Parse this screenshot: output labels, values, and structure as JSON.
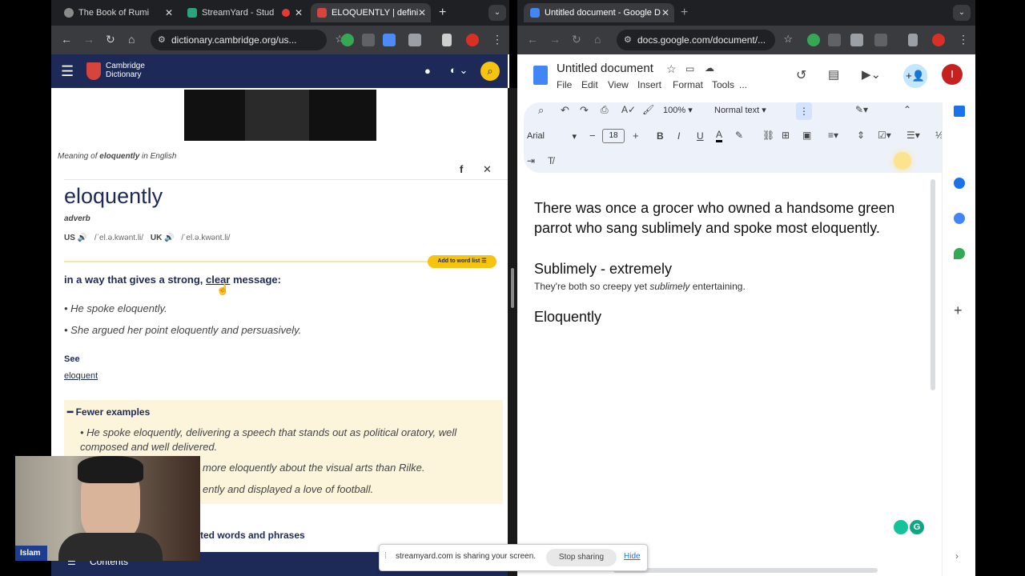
{
  "left_browser": {
    "tabs": [
      {
        "title": "The Book of Rumi"
      },
      {
        "title": "StreamYard - Stud"
      },
      {
        "title": "ELOQUENTLY | defini"
      }
    ],
    "url": "dictionary.cambridge.org/us...",
    "logo": {
      "line1": "Cambridge",
      "line2": "Dictionary"
    },
    "meaning_prefix": "Meaning of ",
    "meaning_word": "eloquently",
    "meaning_suffix": " in English",
    "headword": "eloquently",
    "pos": "adverb",
    "us_label": "US",
    "us_ipa": "/ˈel.ə.kwənt.li/",
    "uk_label": "UK",
    "uk_ipa": "/ˈel.ə.kwənt.li/",
    "add_to_list": "Add to word list",
    "definition_start": "in a way that gives a strong, ",
    "definition_link": "clear",
    "definition_end": " message:",
    "examples": [
      "He spoke eloquently.",
      "She argued her point eloquently and persuasively."
    ],
    "see_label": "See",
    "see_link": "eloquent",
    "fewer_label": "Fewer examples",
    "more_examples": [
      "He spoke eloquently, delivering a speech that stands out as political oratory, well composed and well delivered.",
      "more eloquently about the visual arts than Rilke.",
      "ently and displayed a love of football."
    ],
    "related_label": "ted words and phrases",
    "contents_label": "Contents",
    "webcam_name": "Islam"
  },
  "right_browser": {
    "tab_title": "Untitled document - Google D",
    "url": "docs.google.com/document/...",
    "doc_title": "Untitled document",
    "menus": [
      "File",
      "Edit",
      "View",
      "Insert",
      "Format",
      "Tools",
      "..."
    ],
    "zoom": "100%",
    "style": "Normal text",
    "font": "Arial",
    "font_size": "18",
    "avatar_letter": "I",
    "doc": {
      "p1": "There was once a grocer who owned a handsome green parrot who sang sublimely and spoke most eloquently.",
      "h1": "Sublimely - extremely",
      "s1_start": "They're both so creepy yet ",
      "s1_em": "sublimely",
      "s1_end": " entertaining.",
      "h2": "Eloquently"
    }
  },
  "share_bar": {
    "message": "streamyard.com is sharing your screen.",
    "stop": "Stop sharing",
    "hide": "Hide"
  },
  "colors": {
    "cambridge_navy": "#1d2a57",
    "cambridge_yellow": "#f6c30f",
    "docs_blue": "#1a73e8",
    "browser_dark": "#3a3b3f"
  }
}
